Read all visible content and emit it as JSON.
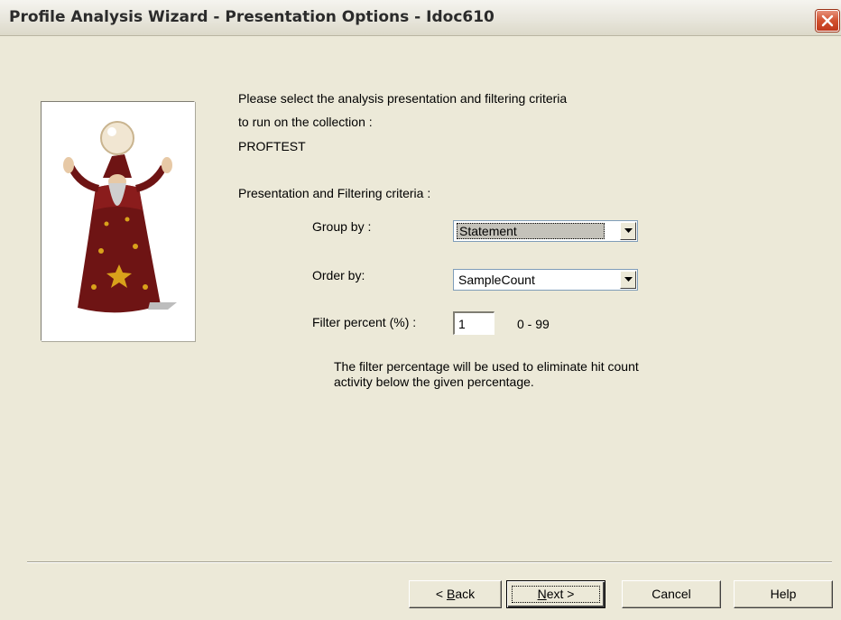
{
  "window": {
    "title": "Profile Analysis Wizard - Presentation Options - Idoc610"
  },
  "intro": {
    "line1": "Please select the analysis presentation and filtering criteria",
    "line2": "to run on the collection :",
    "collection": "PROFTEST"
  },
  "section_label": "Presentation and Filtering criteria :",
  "group_by": {
    "label": "Group by :",
    "value": "Statement"
  },
  "order_by": {
    "label": "Order by:",
    "value": "SampleCount"
  },
  "filter": {
    "label": "Filter percent (%) :",
    "value": "1",
    "range": "0 - 99"
  },
  "note": {
    "line1": "The filter percentage will be used to eliminate hit count",
    "line2": "activity below the given percentage."
  },
  "buttons": {
    "back": {
      "accel": "B",
      "pre": "< ",
      "rest": "ack"
    },
    "next": {
      "accel": "N",
      "rest": "ext >"
    },
    "cancel": "Cancel",
    "help": "Help"
  },
  "icons": {
    "close": "close-x-icon",
    "dropdown": "chevron-down-icon",
    "wizard": "wizard-illustration"
  },
  "colors": {
    "window_bg": "#ece9d8",
    "close_button": "#d2512f",
    "field_border": "#7f9db9"
  }
}
